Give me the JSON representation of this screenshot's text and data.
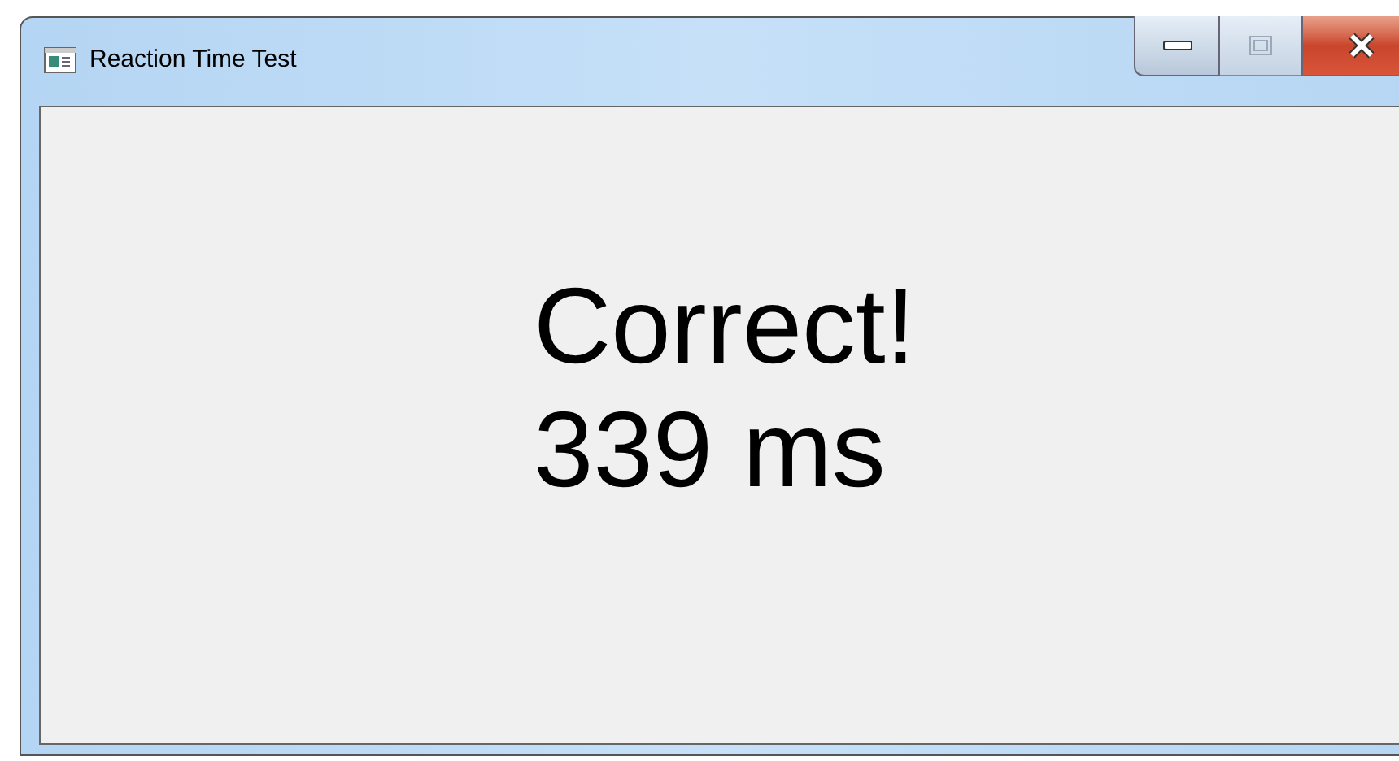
{
  "window": {
    "title": "Reaction Time Test"
  },
  "message": {
    "result": "Correct!",
    "time": "339 ms"
  }
}
